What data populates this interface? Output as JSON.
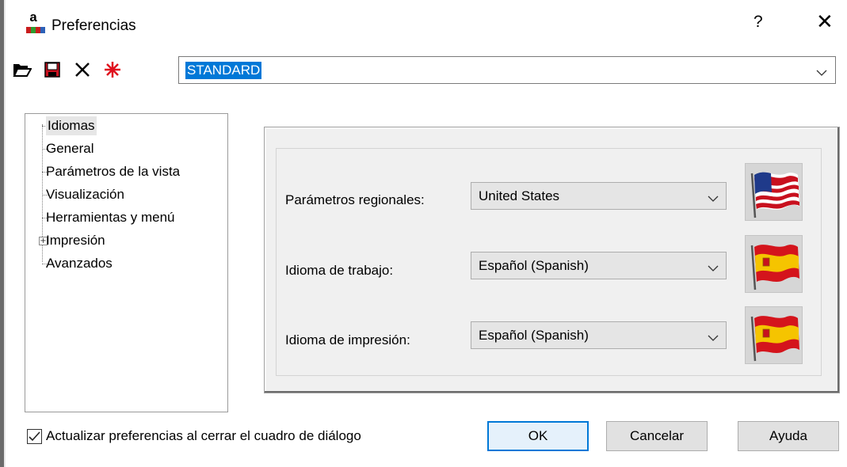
{
  "window": {
    "title": "Preferencias",
    "help_glyph": "?",
    "close_glyph": "✕",
    "app_icon_letter": "a"
  },
  "toolbar": {
    "icons": [
      "open-folder-icon",
      "save-icon",
      "delete-icon",
      "new-profile-icon"
    ]
  },
  "profile": {
    "selected": "STANDARD"
  },
  "tree": {
    "items": [
      {
        "label": "Idiomas",
        "selected": true
      },
      {
        "label": "General"
      },
      {
        "label": "Parámetros de la vista"
      },
      {
        "label": "Visualización"
      },
      {
        "label": "Herramientas y menú"
      },
      {
        "label": "Impresión",
        "expandable": true
      },
      {
        "label": "Avanzados"
      }
    ],
    "expander_glyph": "+"
  },
  "settings": {
    "regional": {
      "label": "Parámetros regionales:",
      "value": "United States",
      "flag": "us-flag-icon"
    },
    "working_language": {
      "label": "Idioma de trabajo:",
      "value": "Español (Spanish)",
      "flag": "spain-flag-icon"
    },
    "print_language": {
      "label": "Idioma de impresión:",
      "value": "Español (Spanish)",
      "flag": "spain-flag-icon"
    }
  },
  "footer": {
    "checkbox_label": "Actualizar preferencias al cerrar el cuadro de diálogo",
    "checkbox_checked": true,
    "ok_label": "OK",
    "cancel_label": "Cancelar",
    "help_label": "Ayuda"
  },
  "colors": {
    "selection": "#0078d7",
    "panel_bg": "#f0f0f0",
    "button_bg": "#e1e1e1"
  }
}
